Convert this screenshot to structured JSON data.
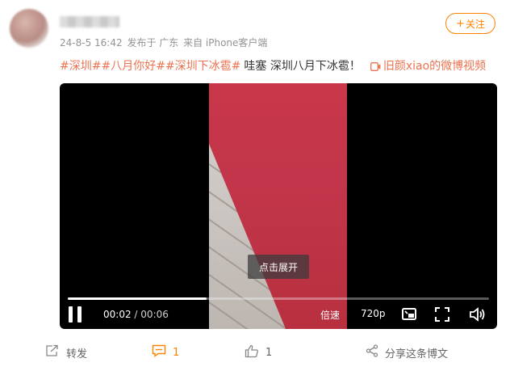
{
  "post": {
    "timestamp": "24-8-5 16:42",
    "published_from": "发布于 广东",
    "source": "来自 iPhone客户端",
    "follow_label": "关注",
    "topics": [
      "#深圳#",
      "#八月你好#",
      "#深圳下冰雹#"
    ],
    "text": "哇塞 深圳八月下冰雹！",
    "video_link_label": "旧颜xiao的微博视频"
  },
  "video": {
    "expand_hint": "点击展开",
    "current_time": "00:02",
    "separator": "/",
    "duration": "00:06",
    "progress_fraction": 0.33,
    "speed_label": "倍速",
    "quality_label": "720p",
    "state": "playing"
  },
  "footer": {
    "repost_label": "转发",
    "comment_count": "1",
    "like_count": "1",
    "share_label": "分享这条博文"
  },
  "colors": {
    "accent": "#ff8200",
    "topic": "#eb7350",
    "muted": "#939393"
  },
  "icons": {
    "repost": "repost-icon",
    "comment": "comment-icon",
    "like": "thumbs-up-icon",
    "share": "share-icon"
  }
}
